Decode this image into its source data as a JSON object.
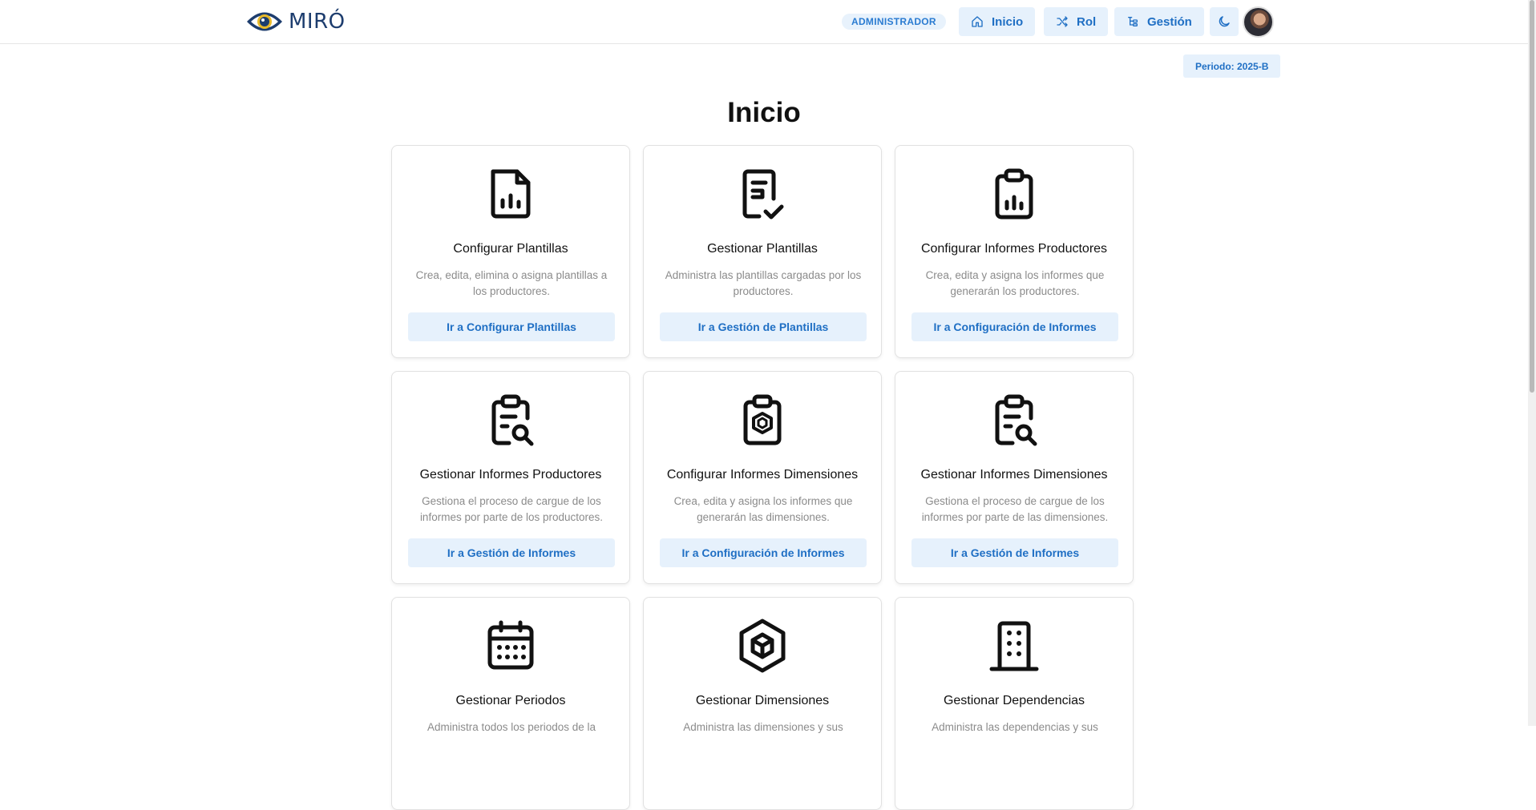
{
  "header": {
    "logo_text": "MIRÓ",
    "role_badge": "ADMINISTRADOR",
    "nav": [
      {
        "label": "Inicio",
        "icon": "home-icon"
      },
      {
        "label": "Rol",
        "icon": "shuffle-icon"
      },
      {
        "label": "Gestión",
        "icon": "hierarchy-icon"
      }
    ],
    "theme_icon": "moon-icon"
  },
  "period_badge": "Periodo: 2025-B",
  "page_title": "Inicio",
  "cards": [
    {
      "title": "Configurar Plantillas",
      "description": "Crea, edita, elimina o asigna plantillas a los productores.",
      "button": "Ir a Configurar Plantillas",
      "icon": "file-chart-icon"
    },
    {
      "title": "Gestionar Plantillas",
      "description": "Administra las plantillas cargadas por los productores.",
      "button": "Ir a Gestión de Plantillas",
      "icon": "file-check-icon"
    },
    {
      "title": "Configurar Informes Productores",
      "description": "Crea, edita y asigna los informes que generarán los productores.",
      "button": "Ir a Configuración de Informes",
      "icon": "clipboard-chart-icon"
    },
    {
      "title": "Gestionar Informes Productores",
      "description": "Gestiona el proceso de cargue de los informes por parte de los productores.",
      "button": "Ir a Gestión de Informes",
      "icon": "clipboard-search-icon"
    },
    {
      "title": "Configurar Informes Dimensiones",
      "description": "Crea, edita y asigna los informes que generarán las dimensiones.",
      "button": "Ir a Configuración de Informes",
      "icon": "clipboard-cube-icon"
    },
    {
      "title": "Gestionar Informes Dimensiones",
      "description": "Gestiona el proceso de cargue de los informes por parte de las dimensiones.",
      "button": "Ir a Gestión de Informes",
      "icon": "clipboard-search-icon"
    },
    {
      "title": "Gestionar Periodos",
      "description": "Administra todos los periodos de la",
      "button": "",
      "icon": "calendar-icon"
    },
    {
      "title": "Gestionar Dimensiones",
      "description": "Administra las dimensiones y sus",
      "button": "",
      "icon": "cube-icon"
    },
    {
      "title": "Gestionar Dependencias",
      "description": "Administra las dependencias y sus",
      "button": "",
      "icon": "building-icon"
    }
  ]
}
